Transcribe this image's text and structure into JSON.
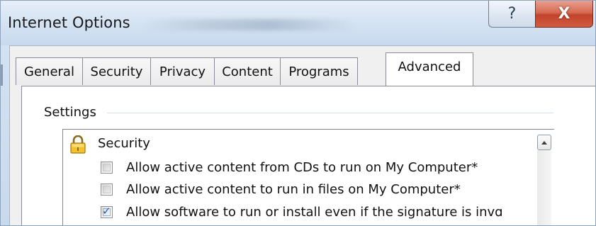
{
  "window": {
    "title": "Internet Options",
    "help_label": "?",
    "close_label": "X"
  },
  "tabs": [
    {
      "label": "General",
      "active": false
    },
    {
      "label": "Security",
      "active": false
    },
    {
      "label": "Privacy",
      "active": false
    },
    {
      "label": "Content",
      "active": false
    },
    {
      "label": "Programs",
      "active": false
    },
    {
      "label": "Advanced",
      "active": true
    }
  ],
  "settings": {
    "group_label": "Settings",
    "category": {
      "label": "Security",
      "icon": "lock-icon"
    },
    "items": [
      {
        "label": "Allow active content from CDs to run on My Computer*",
        "checked": false
      },
      {
        "label": "Allow active content to run in files on My Computer*",
        "checked": false
      },
      {
        "label": "Allow software to run or install even if the signature is invɑ",
        "checked": true
      }
    ]
  },
  "colors": {
    "close_button": "#c2432b",
    "titlebar": "#d6e4f3",
    "checkmark": "#3c5a93"
  }
}
